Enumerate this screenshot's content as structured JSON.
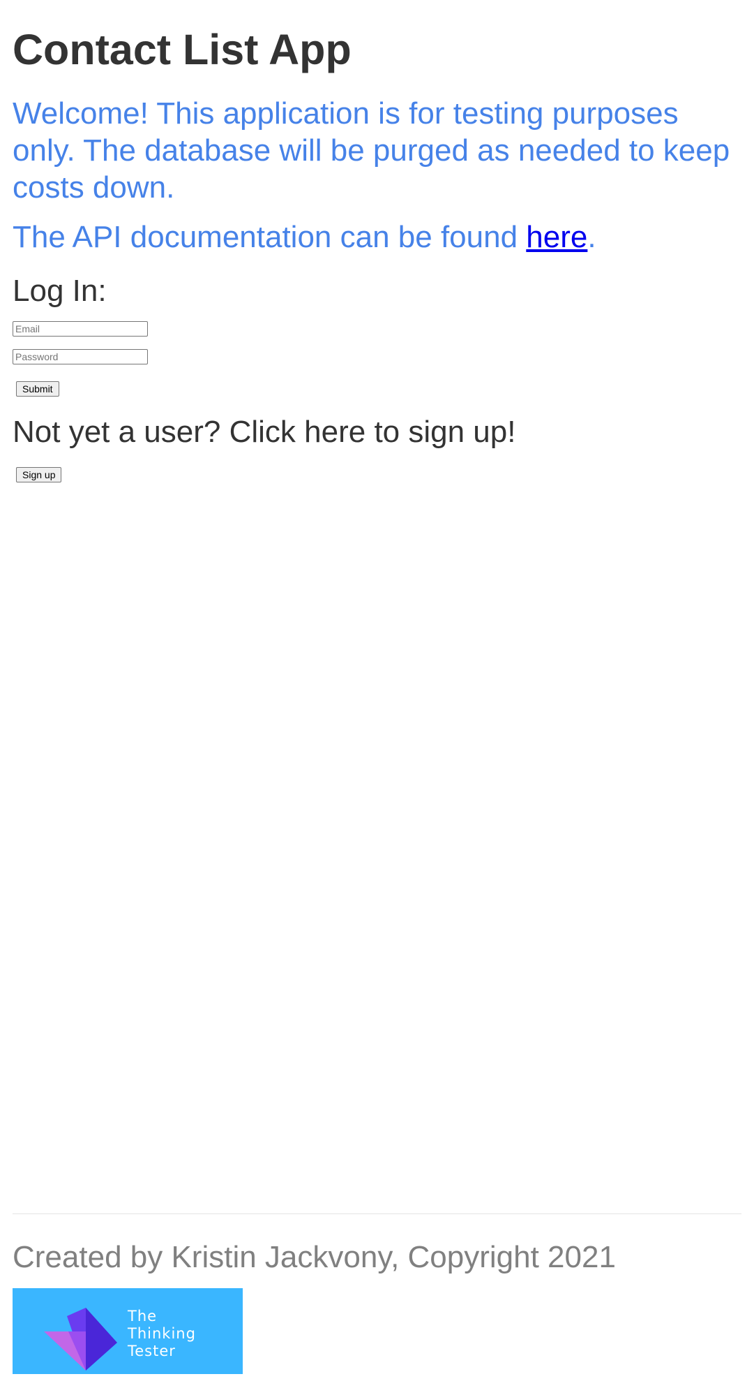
{
  "header": {
    "title": "Contact List App"
  },
  "intro": {
    "welcome": "Welcome! This application is for testing purposes only. The database will be purged as needed to keep costs down.",
    "api_prefix": "The API documentation can be found ",
    "api_link": "here",
    "api_suffix": "."
  },
  "login": {
    "title": "Log In:",
    "email_placeholder": "Email",
    "password_placeholder": "Password",
    "submit_label": "Submit"
  },
  "signup": {
    "title": "Not yet a user? Click here to sign up!",
    "button_label": "Sign up"
  },
  "footer": {
    "text": "Created by Kristin Jackvony, Copyright 2021",
    "logo": {
      "icon": "thinking-tester-logo",
      "bg_color": "#3ab6ff",
      "lines": [
        "The",
        "Thinking",
        "Tester"
      ]
    }
  }
}
